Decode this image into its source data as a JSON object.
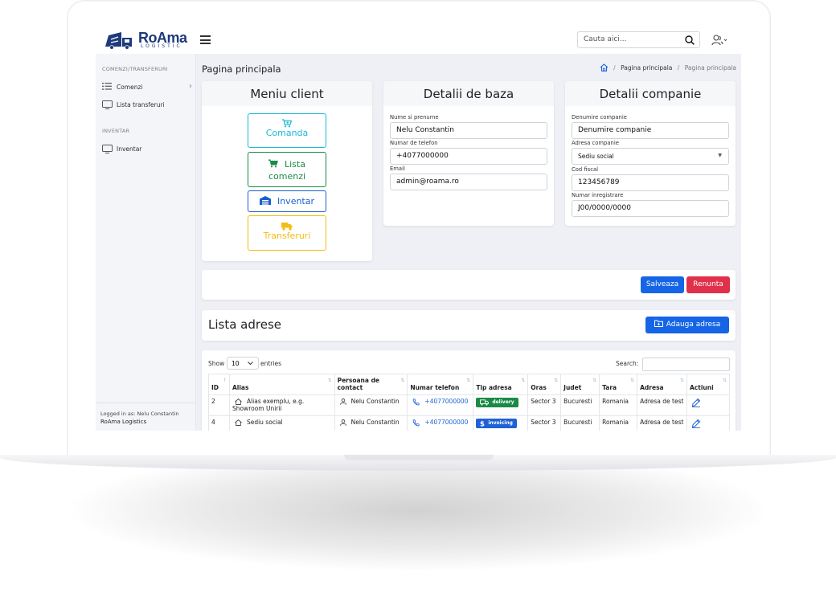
{
  "header": {
    "logo_text": "RoAma",
    "logo_sub": "LOGISTIC",
    "search_placeholder": "Cauta aici..."
  },
  "sidebar": {
    "section1": "COMENZI/TRANSFERURI",
    "items1": [
      {
        "label": "Comenzi"
      },
      {
        "label": "Lista transferuri"
      }
    ],
    "section2": "INVENTAR",
    "items2": [
      {
        "label": "Inventar"
      }
    ],
    "footer_logged": "Logged in as: Nelu Constantin",
    "footer_company": "RoAma Logistics"
  },
  "page": {
    "title": "Pagina principala",
    "breadcrumb": [
      "Pagina principala",
      "Pagina principala"
    ]
  },
  "menu_card": {
    "title": "Meniu client",
    "buttons": [
      {
        "label_line1": "Comanda",
        "label_line2": "",
        "color": "#17b9d4"
      },
      {
        "label_line1": "Lista",
        "label_line2": "comenzi",
        "color": "#1a8a46"
      },
      {
        "label_line1": "Inventar",
        "label_line2": "",
        "color": "#1a5fd1"
      },
      {
        "label_line1": "Transferuri",
        "label_line2": "",
        "color": "#f2bd14"
      }
    ]
  },
  "base_card": {
    "title": "Detalii de baza",
    "fields": [
      {
        "label": "Nume si prenume",
        "value": "Nelu Constantin"
      },
      {
        "label": "Numar de telefon",
        "value": "+4077000000"
      },
      {
        "label": "Email",
        "value": "admin@roama.ro"
      }
    ]
  },
  "company_card": {
    "title": "Detalii companie",
    "fields": [
      {
        "label": "Denumire companie",
        "value": "Denumire companie"
      },
      {
        "label": "Adresa companie",
        "value": "Sediu social"
      },
      {
        "label": "Cod fiscal",
        "value": "123456789"
      },
      {
        "label": "Numar inregistrare",
        "value": "J00/0000/0000"
      }
    ]
  },
  "actions": {
    "save": "Salveaza",
    "cancel": "Renunta",
    "save_color": "#1565e6",
    "cancel_color": "#e0314b"
  },
  "addresses": {
    "title": "Lista adrese",
    "add_button": "Adauga adresa",
    "show_label": "Show",
    "entries_value": "10",
    "entries_label": "entries",
    "search_label": "Search:",
    "columns": [
      "ID",
      "Alias",
      "Persoana de contact",
      "Numar telefon",
      "Tip adresa",
      "Oras",
      "Judet",
      "Tara",
      "Adresa",
      "Actiuni"
    ],
    "rows": [
      {
        "id": "2",
        "alias": "Alias exemplu, e.g. Showroom Unirii",
        "contact": "Nelu Constantin",
        "phone": "+4077000000",
        "type": "delivery",
        "type_color": "#1a8a46",
        "city": "Sector 3",
        "county": "Bucuresti",
        "country": "Romania",
        "address": "Adresa de test"
      },
      {
        "id": "4",
        "alias": "Sediu social",
        "contact": "Nelu Constantin",
        "phone": "+4077000000",
        "type": "invoicing",
        "type_color": "#1e62d6",
        "city": "Sector 3",
        "county": "Bucuresti",
        "country": "Romania",
        "address": "Adresa de test"
      }
    ]
  }
}
